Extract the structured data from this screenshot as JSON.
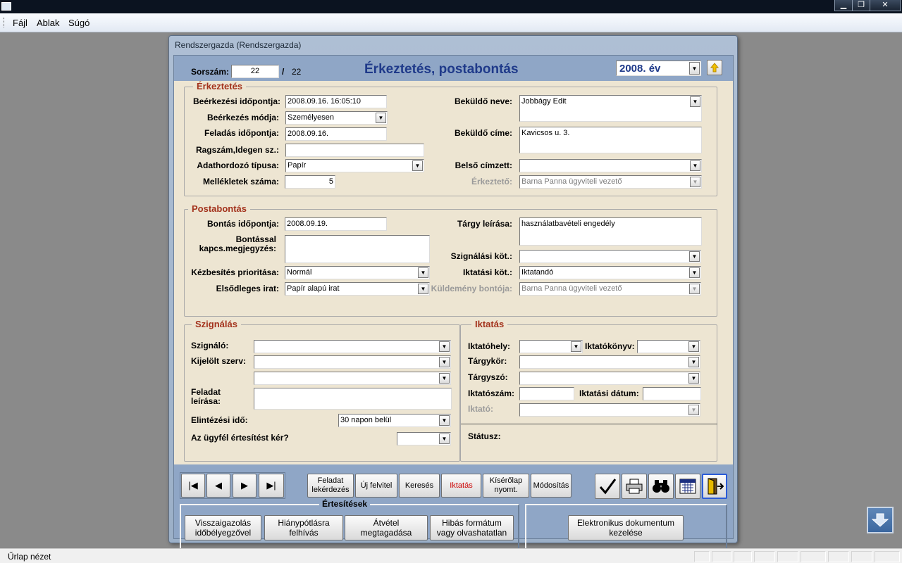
{
  "app": {
    "menu": [
      "Fájl",
      "Ablak",
      "Súgó"
    ],
    "window_buttons": {
      "minimize": "▁",
      "restore": "❐",
      "close": "✕"
    }
  },
  "form": {
    "title": "Rendszergazda  (Rendszergazda)",
    "heading": "Érkeztetés, postabontás",
    "record_label": "Sorszám:",
    "record_current": "22",
    "record_separator": "/",
    "record_total": "22",
    "year": "2008. év",
    "arrival": {
      "legend": "Érkeztetés",
      "received_label": "Beérkezési időpontja:",
      "received_value": "2008.09.16. 16:05:10",
      "mode_label": "Beérkezés módja:",
      "mode_value": "Személyesen",
      "posted_label": "Feladás időpontja:",
      "posted_value": "2008.09.16.",
      "ragszam_label": "Ragszám,Idegen sz.:",
      "ragszam_value": "",
      "medium_label": "Adathordozó típusa:",
      "medium_value": "Papír",
      "attachments_label": "Mellékletek száma:",
      "attachments_value": "5",
      "sender_name_label": "Beküldő neve:",
      "sender_name_value": "Jobbágy Edit",
      "sender_addr_label": "Beküldő címe:",
      "sender_addr_value": "Kavicsos u. 3.",
      "internal_label": "Belső címzett:",
      "internal_value": "",
      "registrar_label": "Érkeztető:",
      "registrar_value": "Barna Panna ügyviteli vezető"
    },
    "opening": {
      "legend": "Postabontás",
      "open_date_label": "Bontás időpontja:",
      "open_date_value": "2008.09.19.",
      "note_label_1": "Bontással",
      "note_label_2": "kapcs.megjegyzés:",
      "note_value": "",
      "priority_label": "Kézbesítés prioritása:",
      "priority_value": "Normál",
      "primary_label": "Elsődleges irat:",
      "primary_value": "Papír alapú irat",
      "subject_label": "Tárgy leírása:",
      "subject_value": "használatbavételi engedély",
      "sign_req_label": "Szignálási köt.:",
      "sign_req_value": "",
      "file_req_label": "Iktatási köt.:",
      "file_req_value": "Iktatandó",
      "opener_label": "Küldemény bontója:",
      "opener_value": "Barna Panna ügyviteli vezető"
    },
    "signing": {
      "legend": "Szignálás",
      "signer_label": "Szignáló:",
      "org_label": "Kijelölt szerv:",
      "task_label_1": "Feladat",
      "task_label_2": "leírása:",
      "deadline_label": "Elintézési idő:",
      "deadline_value": "30 napon belül",
      "notify_label": "Az ügyfél értesítést kér?"
    },
    "filing": {
      "legend": "Iktatás",
      "place_label": "Iktatóhely:",
      "book_label": "Iktatókönyv:",
      "topic_label": "Tárgykör:",
      "keyword_label": "Tárgyszó:",
      "number_label": "Iktatószám:",
      "date_label": "Iktatási dátum:",
      "clerk_label": "Iktató:",
      "status_label": "Státusz:"
    },
    "nav": {
      "first": "|◀",
      "prev": "◀",
      "next": "▶",
      "last": "▶|"
    },
    "actions": {
      "task_query_1": "Feladat",
      "task_query_2": "lekérdezés",
      "new_record": "Új felvitel",
      "search": "Keresés",
      "filing": "Iktatás",
      "cover_1": "Kísérőlap",
      "cover_2": "nyomt.",
      "modify": "Módosítás"
    },
    "notifications": {
      "legend": "Értesítések",
      "confirm_1": "Visszaigazolás",
      "confirm_2": "időbélyegzővel",
      "missing_1": "Hiánypótlásra",
      "missing_2": "felhívás",
      "refuse_1": "Átvétel",
      "refuse_2": "megtagadása",
      "bad_format_1": "Hibás formátum",
      "bad_format_2": "vagy olvashatatlan",
      "edoc_1": "Elektronikus dokumentum",
      "edoc_2": "kezelése"
    }
  },
  "status": {
    "text": "Űrlap nézet"
  },
  "colors": {
    "panel": "#ede5d2",
    "legend": "#a3321c",
    "heading": "#1f3a8a",
    "form_blue": "#8fa6c6"
  }
}
